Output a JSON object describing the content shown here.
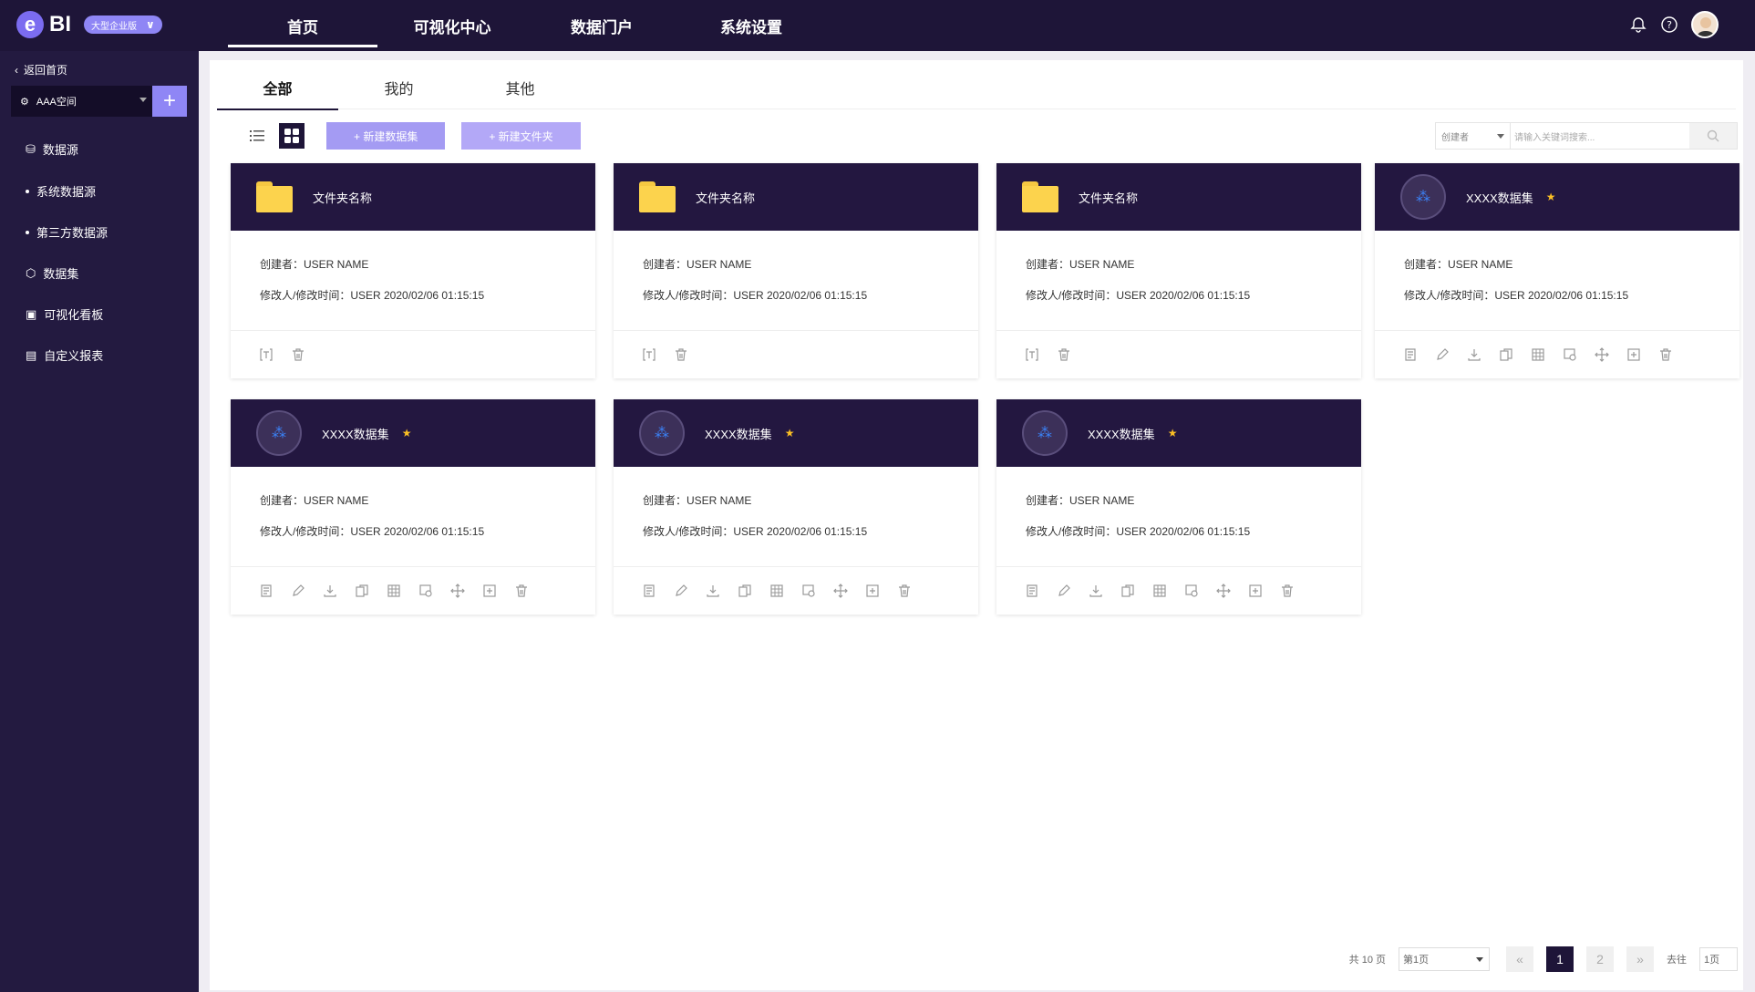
{
  "header": {
    "logo_letter": "e",
    "logo_text": "BI",
    "edition": "大型企业版",
    "nav": [
      "首页",
      "可视化中心",
      "数据门户",
      "系统设置"
    ],
    "active_nav": 0
  },
  "sidebar": {
    "back": "返回首页",
    "space": "AAA空间",
    "items": [
      {
        "label": "数据源",
        "icon": "database-icon"
      },
      {
        "label": "系统数据源",
        "icon": "dot"
      },
      {
        "label": "第三方数据源",
        "icon": "dot"
      },
      {
        "label": "数据集",
        "icon": "cube-icon"
      },
      {
        "label": "可视化看板",
        "icon": "dashboard-icon"
      },
      {
        "label": "自定义报表",
        "icon": "report-icon"
      }
    ]
  },
  "tabs": [
    "全部",
    "我的",
    "其他"
  ],
  "toolbar": {
    "new_dataset": "+ 新建数据集",
    "new_folder": "+ 新建文件夹"
  },
  "search": {
    "filter": "创建者",
    "placeholder": "请输入关键词搜索..."
  },
  "cards": [
    {
      "type": "folder",
      "title": "文件夹名称",
      "creator": "创建者：USER NAME",
      "modified": "修改人/修改时间：USER   2020/02/06 01:15:15"
    },
    {
      "type": "folder",
      "title": "文件夹名称",
      "creator": "创建者：USER NAME",
      "modified": "修改人/修改时间：USER   2020/02/06 01:15:15"
    },
    {
      "type": "folder",
      "title": "文件夹名称",
      "creator": "创建者：USER NAME",
      "modified": "修改人/修改时间：USER   2020/02/06 01:15:15"
    },
    {
      "type": "dataset",
      "title": "XXXX数据集",
      "creator": "创建者：USER NAME",
      "modified": "修改人/修改时间：USER  2020/02/06 01:15:15"
    },
    {
      "type": "dataset",
      "title": "XXXX数据集",
      "creator": "创建者：USER NAME",
      "modified": "修改人/修改时间：USER  2020/02/06 01:15:15"
    },
    {
      "type": "dataset",
      "title": "XXXX数据集",
      "creator": "创建者：USER NAME",
      "modified": "修改人/修改时间：USER  2020/02/06 01:15:15"
    },
    {
      "type": "dataset",
      "title": "XXXX数据集",
      "creator": "创建者：USER NAME",
      "modified": "修改人/修改时间：USER  2020/02/06 01:15:15"
    }
  ],
  "pager": {
    "total": "共 10 页",
    "page_select": "第1页",
    "pages": [
      "1",
      "2"
    ],
    "goto_label": "去往",
    "goto_value": "1页"
  }
}
